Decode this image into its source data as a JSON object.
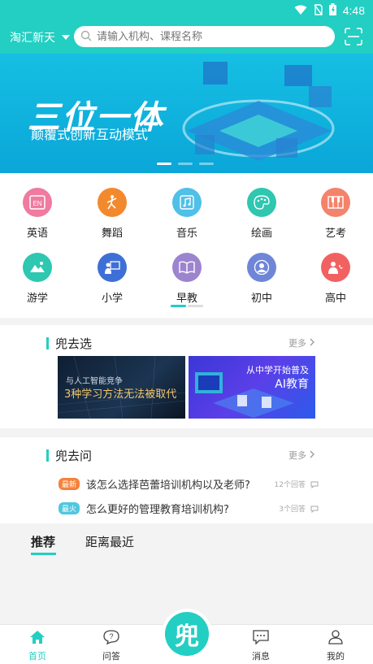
{
  "status_bar": {
    "time": "4:48"
  },
  "header": {
    "city": "淘汇新天",
    "search_placeholder": "请输入机构、课程名称"
  },
  "banner": {
    "title": "三位一体",
    "subtitle": "颠覆式创新互动模式"
  },
  "categories": [
    {
      "label": "英语",
      "icon": "english-icon",
      "color": "#f07aa0"
    },
    {
      "label": "舞蹈",
      "icon": "dance-icon",
      "color": "#f3892d"
    },
    {
      "label": "音乐",
      "icon": "music-icon",
      "color": "#4fc0e8"
    },
    {
      "label": "绘画",
      "icon": "palette-icon",
      "color": "#2ec7b0"
    },
    {
      "label": "艺考",
      "icon": "piano-icon",
      "color": "#f3836b"
    },
    {
      "label": "游学",
      "icon": "landscape-icon",
      "color": "#2ec7b0"
    },
    {
      "label": "小学",
      "icon": "school-icon",
      "color": "#3d6fd6"
    },
    {
      "label": "早教",
      "icon": "book-icon",
      "color": "#9d84cf"
    },
    {
      "label": "初中",
      "icon": "student-icon",
      "color": "#6f86d8"
    },
    {
      "label": "高中",
      "icon": "people-icon",
      "color": "#f26161"
    }
  ],
  "section_choose": {
    "title": "兜去选",
    "more": "更多",
    "image1": {
      "line1": "与人工智能竞争",
      "line2": "3种学习方法无法被取代"
    },
    "image2": {
      "line1": "从中学开始普及",
      "line2": "AI教育"
    }
  },
  "section_ask": {
    "title": "兜去问",
    "more": "更多",
    "questions": [
      {
        "badge": "最新",
        "badge_color": "#f5823a",
        "text": "该怎么选择芭蕾培训机构以及老师?",
        "count": "12个回答"
      },
      {
        "badge": "最火",
        "badge_color": "#4fc7e0",
        "text": "怎么更好的管理教育培训机构?",
        "count": "3个回答"
      }
    ]
  },
  "tabs": [
    {
      "label": "推荐"
    },
    {
      "label": "距离最近"
    }
  ],
  "bottom_nav": {
    "home": "首页",
    "qa": "问答",
    "center": "兜",
    "messages": "消息",
    "mine": "我的"
  },
  "colors": {
    "accent": "#22cfc2"
  }
}
